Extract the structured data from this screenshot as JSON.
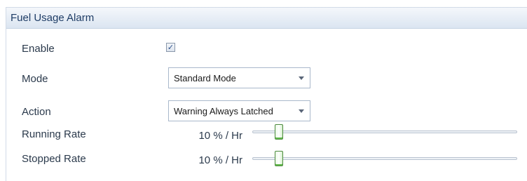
{
  "panel": {
    "title": "Fuel Usage Alarm"
  },
  "enable": {
    "label": "Enable",
    "checked": true,
    "check_glyph": "✓"
  },
  "mode": {
    "label": "Mode",
    "selected": "Standard Mode"
  },
  "action": {
    "label": "Action",
    "selected": "Warning Always Latched"
  },
  "running_rate": {
    "label": "Running Rate",
    "value_text": "10 % / Hr",
    "value": 10
  },
  "stopped_rate": {
    "label": "Stopped Rate",
    "value_text": "10 % / Hr",
    "value": 10
  },
  "colors": {
    "accent": "#1f3d66",
    "slider_thumb": "#62b94a"
  }
}
